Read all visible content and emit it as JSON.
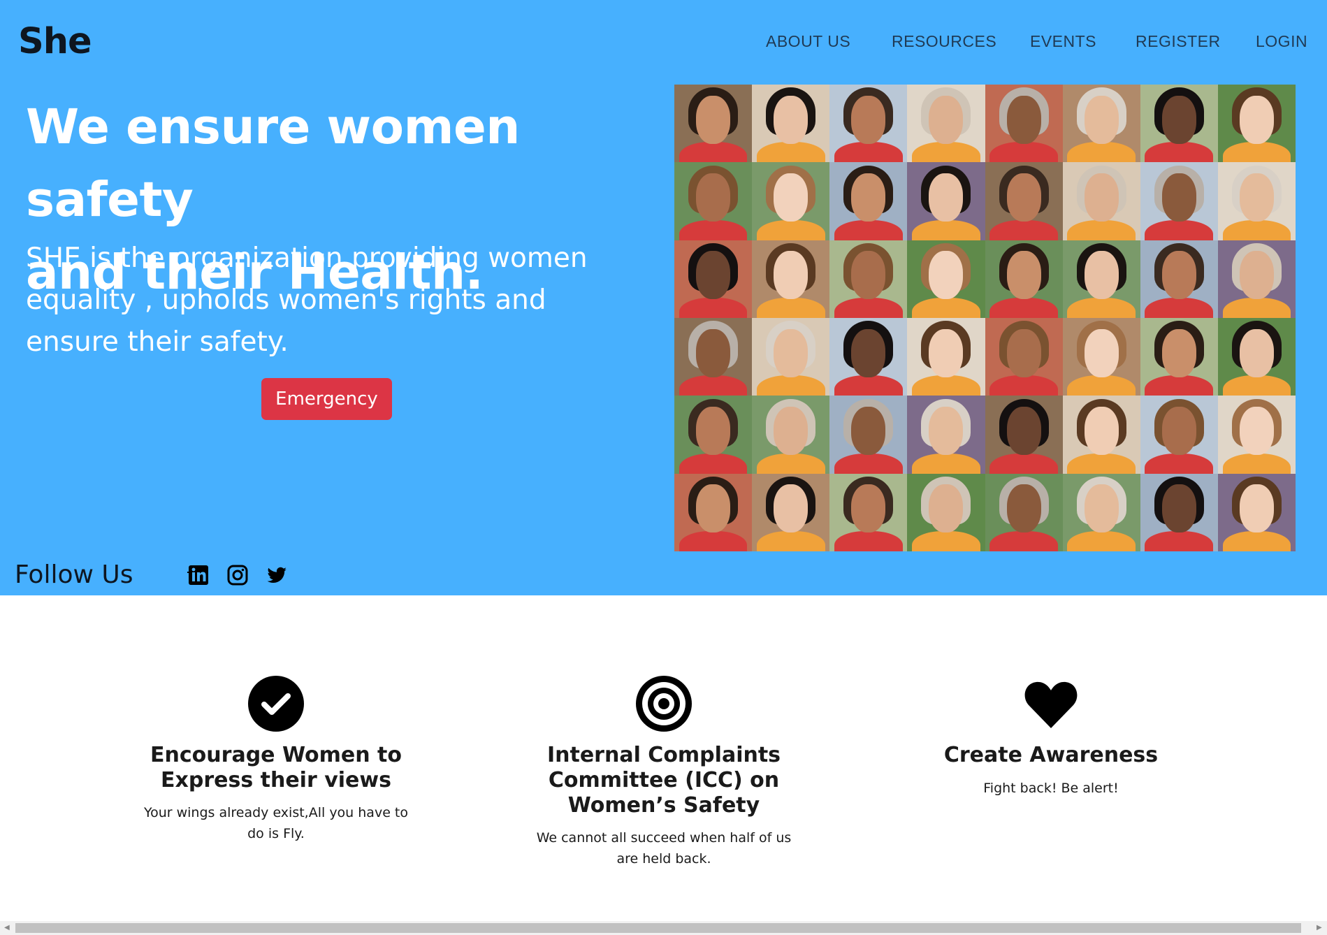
{
  "brand": "She",
  "nav": {
    "about": "ABOUT US",
    "resources": "RESOURCES",
    "events": "EVENTS",
    "register": "REGISTER",
    "login": "LOGIN"
  },
  "hero": {
    "headline_line1": "We ensure women safety",
    "headline_line2": "and their Health.",
    "sub_line1": "SHE is the organization providing women",
    "sub_line2": "equality , upholds women's rights and",
    "sub_line3": "ensure their safety.",
    "emergency_label": "Emergency"
  },
  "follow": {
    "label": "Follow Us",
    "icons": [
      "linkedin-icon",
      "instagram-icon",
      "twitter-icon"
    ]
  },
  "features": [
    {
      "icon": "check-circle-icon",
      "title_line1": "Encourage Women to",
      "title_line2": "Express their views",
      "desc_line1": "Your wings already exist,All you have to",
      "desc_line2": "do is Fly."
    },
    {
      "icon": "target-icon",
      "title_line1": "Internal Complaints",
      "title_line2": "Committee (ICC) on",
      "title_line3": "Women’s Safety",
      "desc_line1": "We cannot all succeed when half of us",
      "desc_line2": "are held back."
    },
    {
      "icon": "heart-icon",
      "title_line1": "Create Awareness",
      "desc_line1": "Fight back! Be alert!"
    }
  ],
  "colors": {
    "hero_bg": "#47b0fe",
    "emergency": "#dc3545",
    "nav_text": "#1f3a55"
  }
}
